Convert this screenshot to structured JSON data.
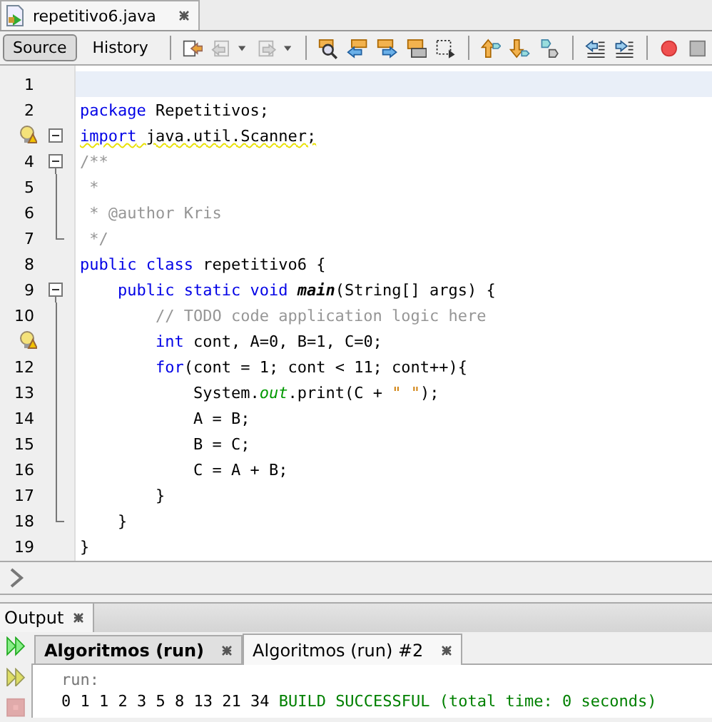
{
  "editor_tab": {
    "title": "repetitivo6.java",
    "selected": true
  },
  "view_tabs": [
    {
      "label": "Source",
      "selected": true
    },
    {
      "label": "History",
      "selected": false
    }
  ],
  "toolbar": [
    {
      "kind": "last-edit",
      "disabled": false
    },
    {
      "kind": "back",
      "disabled": true
    },
    {
      "kind": "forward",
      "disabled": true
    },
    {
      "kind": "find",
      "disabled": false
    },
    {
      "kind": "find-prev",
      "disabled": false
    },
    {
      "kind": "find-next",
      "disabled": false
    },
    {
      "kind": "highlight",
      "disabled": false
    },
    {
      "kind": "rect-select",
      "disabled": false
    },
    {
      "kind": "prev-bookmark",
      "disabled": false
    },
    {
      "kind": "next-bookmark",
      "disabled": false
    },
    {
      "kind": "toggle-bookmark",
      "disabled": false
    },
    {
      "kind": "shift-left",
      "disabled": false
    },
    {
      "kind": "shift-right",
      "disabled": false
    },
    {
      "kind": "record",
      "disabled": false
    },
    {
      "kind": "stop",
      "disabled": false
    }
  ],
  "lines": [
    {
      "number": "1",
      "hint": false,
      "fold_toggle": false,
      "fold_line": false,
      "fold_end": false,
      "current": true,
      "warning": false
    },
    {
      "number": "2",
      "hint": false,
      "fold_toggle": false,
      "fold_line": false,
      "fold_end": false,
      "current": false,
      "warning": false,
      "segments": [
        {
          "kind": "keyword",
          "text": "package"
        },
        {
          "kind": "plain",
          "text": " Repetitivos;"
        }
      ]
    },
    {
      "hint": true,
      "fold_toggle": true,
      "fold_line": false,
      "fold_end": false,
      "current": false,
      "warning": true,
      "segments": [
        {
          "kind": "keyword",
          "text": "import"
        },
        {
          "kind": "plain",
          "text": " java.util.Scanner;"
        }
      ]
    },
    {
      "number": "4",
      "hint": false,
      "fold_toggle": true,
      "fold_line": false,
      "fold_end": false,
      "current": false,
      "warning": false,
      "segments": [
        {
          "kind": "comment",
          "text": "/**"
        }
      ]
    },
    {
      "number": "5",
      "hint": false,
      "fold_toggle": false,
      "fold_line": true,
      "fold_end": false,
      "current": false,
      "warning": false,
      "segments": [
        {
          "kind": "comment",
          "text": " *"
        }
      ]
    },
    {
      "number": "6",
      "hint": false,
      "fold_toggle": false,
      "fold_line": true,
      "fold_end": false,
      "current": false,
      "warning": false,
      "segments": [
        {
          "kind": "comment",
          "text": " * @author Kris"
        }
      ]
    },
    {
      "number": "7",
      "hint": false,
      "fold_toggle": false,
      "fold_line": false,
      "fold_end": true,
      "current": false,
      "warning": false,
      "segments": [
        {
          "kind": "comment",
          "text": " */"
        }
      ]
    },
    {
      "number": "8",
      "hint": false,
      "fold_toggle": false,
      "fold_line": false,
      "fold_end": false,
      "current": false,
      "warning": false,
      "segments": [
        {
          "kind": "keyword",
          "text": "public class"
        },
        {
          "kind": "plain",
          "text": " repetitivo6 {"
        }
      ]
    },
    {
      "number": "9",
      "hint": false,
      "fold_toggle": true,
      "fold_line": false,
      "fold_end": false,
      "current": false,
      "warning": false,
      "segments": [
        {
          "kind": "keyword",
          "text": "    public static void "
        },
        {
          "kind": "method",
          "text": "main"
        },
        {
          "kind": "plain",
          "text": "(String[] args) {"
        }
      ]
    },
    {
      "number": "10",
      "hint": false,
      "fold_toggle": false,
      "fold_line": true,
      "fold_end": false,
      "current": false,
      "warning": false,
      "segments": [
        {
          "kind": "comment",
          "text": "        // TODO code application logic here"
        }
      ]
    },
    {
      "hint": true,
      "fold_toggle": false,
      "fold_line": true,
      "fold_end": false,
      "current": false,
      "warning": false,
      "segments": [
        {
          "kind": "keyword",
          "text": "        int"
        },
        {
          "kind": "plain",
          "text": " cont, A=0, B=1, C=0;"
        }
      ]
    },
    {
      "number": "12",
      "hint": false,
      "fold_toggle": false,
      "fold_line": true,
      "fold_end": false,
      "current": false,
      "warning": false,
      "segments": [
        {
          "kind": "keyword",
          "text": "        for"
        },
        {
          "kind": "plain",
          "text": "(cont = 1; cont < 11; cont++){"
        }
      ]
    },
    {
      "number": "13",
      "hint": false,
      "fold_toggle": false,
      "fold_line": true,
      "fold_end": false,
      "current": false,
      "warning": false,
      "segments": [
        {
          "kind": "plain",
          "text": "            System."
        },
        {
          "kind": "field",
          "text": "out"
        },
        {
          "kind": "plain",
          "text": ".print(C + "
        },
        {
          "kind": "string",
          "text": "\" \""
        },
        {
          "kind": "plain",
          "text": ");"
        }
      ]
    },
    {
      "number": "14",
      "hint": false,
      "fold_toggle": false,
      "fold_line": true,
      "fold_end": false,
      "current": false,
      "warning": false,
      "segments": [
        {
          "kind": "plain",
          "text": "            A = B;"
        }
      ]
    },
    {
      "number": "15",
      "hint": false,
      "fold_toggle": false,
      "fold_line": true,
      "fold_end": false,
      "current": false,
      "warning": false,
      "segments": [
        {
          "kind": "plain",
          "text": "            B = C;"
        }
      ]
    },
    {
      "number": "16",
      "hint": false,
      "fold_toggle": false,
      "fold_line": true,
      "fold_end": false,
      "current": false,
      "warning": false,
      "segments": [
        {
          "kind": "plain",
          "text": "            C = A + B;"
        }
      ]
    },
    {
      "number": "17",
      "hint": false,
      "fold_toggle": false,
      "fold_line": true,
      "fold_end": false,
      "current": false,
      "warning": false,
      "segments": [
        {
          "kind": "plain",
          "text": "        }"
        }
      ]
    },
    {
      "number": "18",
      "hint": false,
      "fold_toggle": false,
      "fold_line": false,
      "fold_end": true,
      "current": false,
      "warning": false,
      "segments": [
        {
          "kind": "plain",
          "text": "    }"
        }
      ]
    },
    {
      "number": "19",
      "hint": false,
      "fold_toggle": false,
      "fold_line": false,
      "fold_end": false,
      "current": false,
      "warning": false,
      "segments": [
        {
          "kind": "plain",
          "text": "}"
        }
      ]
    }
  ],
  "output": {
    "title": "Output",
    "tabs": [
      {
        "label": "Algoritmos (run)",
        "selected": false,
        "unread": true
      },
      {
        "label": "Algoritmos (run) #2",
        "selected": true,
        "unread": false
      }
    ],
    "actions": [
      {
        "kind": "rerun",
        "disabled": false
      },
      {
        "kind": "rerun-with",
        "disabled": false
      },
      {
        "kind": "stop",
        "disabled": true
      }
    ],
    "lines": [
      [
        {
          "kind": "info",
          "text": "run:"
        }
      ],
      [
        {
          "kind": "plain",
          "text": "0 1 1 2 3 5 8 13 21 34 "
        },
        {
          "kind": "success",
          "text": "BUILD SUCCESSFUL (total time: 0 seconds)"
        }
      ]
    ]
  }
}
